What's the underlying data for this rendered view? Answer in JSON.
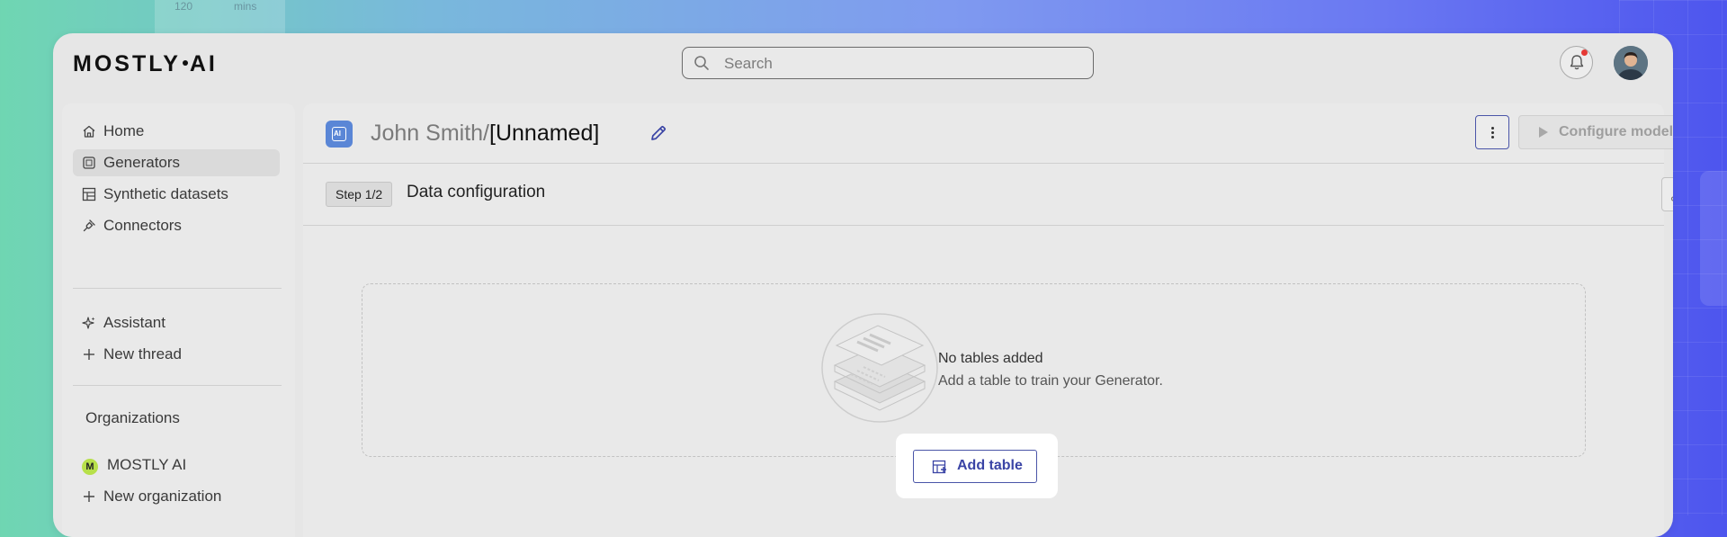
{
  "background": {
    "label_1": "120",
    "label_2": "mins"
  },
  "app": {
    "logo_text": "MOSTLY·AI"
  },
  "search": {
    "placeholder": "Search"
  },
  "sidebar": {
    "items": [
      {
        "label": "Home",
        "icon": "home-icon"
      },
      {
        "label": "Generators",
        "icon": "generator-icon",
        "active": true
      },
      {
        "label": "Synthetic datasets",
        "icon": "dataset-table-icon"
      },
      {
        "label": "Connectors",
        "icon": "plug-icon"
      }
    ],
    "assistant_items": [
      {
        "label": "Assistant",
        "icon": "sparkle-icon"
      },
      {
        "label": "New thread",
        "icon": "plus-icon"
      }
    ],
    "organizations_title": "Organizations",
    "org_items": [
      {
        "label": "MOSTLY AI",
        "badge": "M"
      },
      {
        "label": "New organization",
        "icon": "plus-icon"
      }
    ]
  },
  "generator": {
    "owner": "John Smith/",
    "name": "[Unnamed]",
    "configure_label": "Configure models"
  },
  "step": {
    "badge": "Step 1/2",
    "title": "Data configuration"
  },
  "empty_state": {
    "title": "No tables added",
    "subtitle": "Add a table to train your Generator."
  },
  "actions": {
    "add_table_label": "Add table"
  },
  "colors": {
    "accent": "#3a44a5",
    "generator_icon": "#5a86d6",
    "notification_dot": "#e53935",
    "org_badge": "#b7e04a"
  }
}
